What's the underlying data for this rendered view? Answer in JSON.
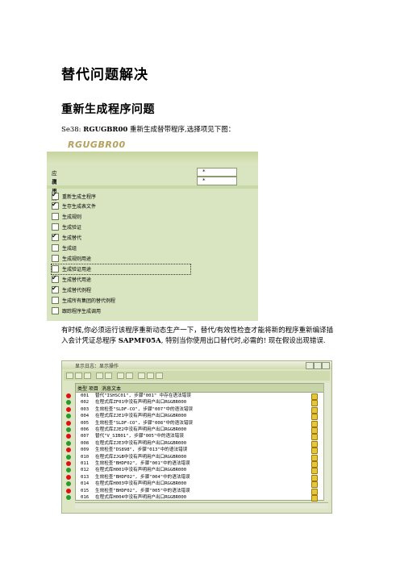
{
  "heading1": "替代问题解决",
  "heading2": "重新生成程序问题",
  "intro": {
    "prefix": "Se38: ",
    "program": "RGUGBR00",
    "rest": " 重新生成替带程序,选择项见下图："
  },
  "screenshot1": {
    "title": "RGUGBR00",
    "fields": [
      {
        "label": "应用领域",
        "value": "*"
      },
      {
        "label": "调用点",
        "value": "*"
      }
    ],
    "checkboxes": [
      {
        "label": "重新生成主程序",
        "checked": true
      },
      {
        "label": "生存生成表文件",
        "checked": true
      },
      {
        "label": "生成规则",
        "checked": false
      },
      {
        "label": "生成验证",
        "checked": false
      },
      {
        "label": "生成替代",
        "checked": true
      },
      {
        "label": "生成组",
        "checked": false
      },
      {
        "label": "生成规则用途",
        "checked": false
      },
      {
        "label": "生成验证用途",
        "checked": false
      },
      {
        "label": "生成替代用途",
        "checked": true
      },
      {
        "label": "生成替代例程",
        "checked": true
      },
      {
        "label": "生成所有集团的替代例程",
        "checked": false
      },
      {
        "label": "跟踪程序生成调用",
        "checked": false
      }
    ]
  },
  "paragraph": {
    "line1": "有时候,你必须运行该程序重新动态生产一下，替代/有效性检查才能将新的程序重新编译插",
    "line2_a": "入会计凭证总程序 ",
    "line2_prog": "SAPMF05A",
    "line2_b": ", 特别当你使用出口替代时,必需的!   现在假设出现错误."
  },
  "screenshot2": {
    "window_title": "显示日志：显示操作",
    "columns": [
      "类型",
      "项目",
      "消息文本"
    ],
    "rows": [
      {
        "status": "red",
        "num": "001",
        "text": "替代\"ISHSC01\", 步骤\"001\" 中存在语法错误"
      },
      {
        "status": "green",
        "num": "002",
        "text": "在程式库ZF01中没有声明用户出口RGGBR000"
      },
      {
        "status": "red",
        "num": "003",
        "text": "生效检查\"SLDF-CO\", 步骤\"007\"中的语法错误"
      },
      {
        "status": "green",
        "num": "004",
        "text": "在程式库ZJE1中没有声明用户出口RGGBR000"
      },
      {
        "status": "red",
        "num": "005",
        "text": "生效检查\"SLDF-CO\", 步骤\"008\"中的语法错误"
      },
      {
        "status": "green",
        "num": "006",
        "text": "在程式库ZJE2中没有声明用户出口RGGBR000"
      },
      {
        "status": "red",
        "num": "007",
        "text": "替代\"V_SIB01\", 步骤\"005\"中的语法错误"
      },
      {
        "status": "green",
        "num": "008",
        "text": "在程式库ZJE3中没有声明用户出口RGGBR000"
      },
      {
        "status": "red",
        "num": "009",
        "text": "生效检查\"DS898\", 步骤\"013\"中的语法错误"
      },
      {
        "status": "green",
        "num": "010",
        "text": "在程式库ZJGB中没有声明用户出口RGGBR000"
      },
      {
        "status": "red",
        "num": "011",
        "text": "生效检查\"BHDF02\", 步骤\"001\"中的语法错误"
      },
      {
        "status": "green",
        "num": "012",
        "text": "在程式库H001中没有声明用户出口RGGBR000"
      },
      {
        "status": "red",
        "num": "013",
        "text": "生效检查\"BHDF02\", 步骤\"004\"中的语法错误"
      },
      {
        "status": "green",
        "num": "014",
        "text": "在程式库H003中没有声明用户出口RGGBR000"
      },
      {
        "status": "red",
        "num": "015",
        "text": "生效检查\"BHDF02\", 步骤\"005\"中的语法错误"
      },
      {
        "status": "green",
        "num": "016",
        "text": "在程式库H004中没有声明用户出口RGGBR000"
      }
    ]
  }
}
